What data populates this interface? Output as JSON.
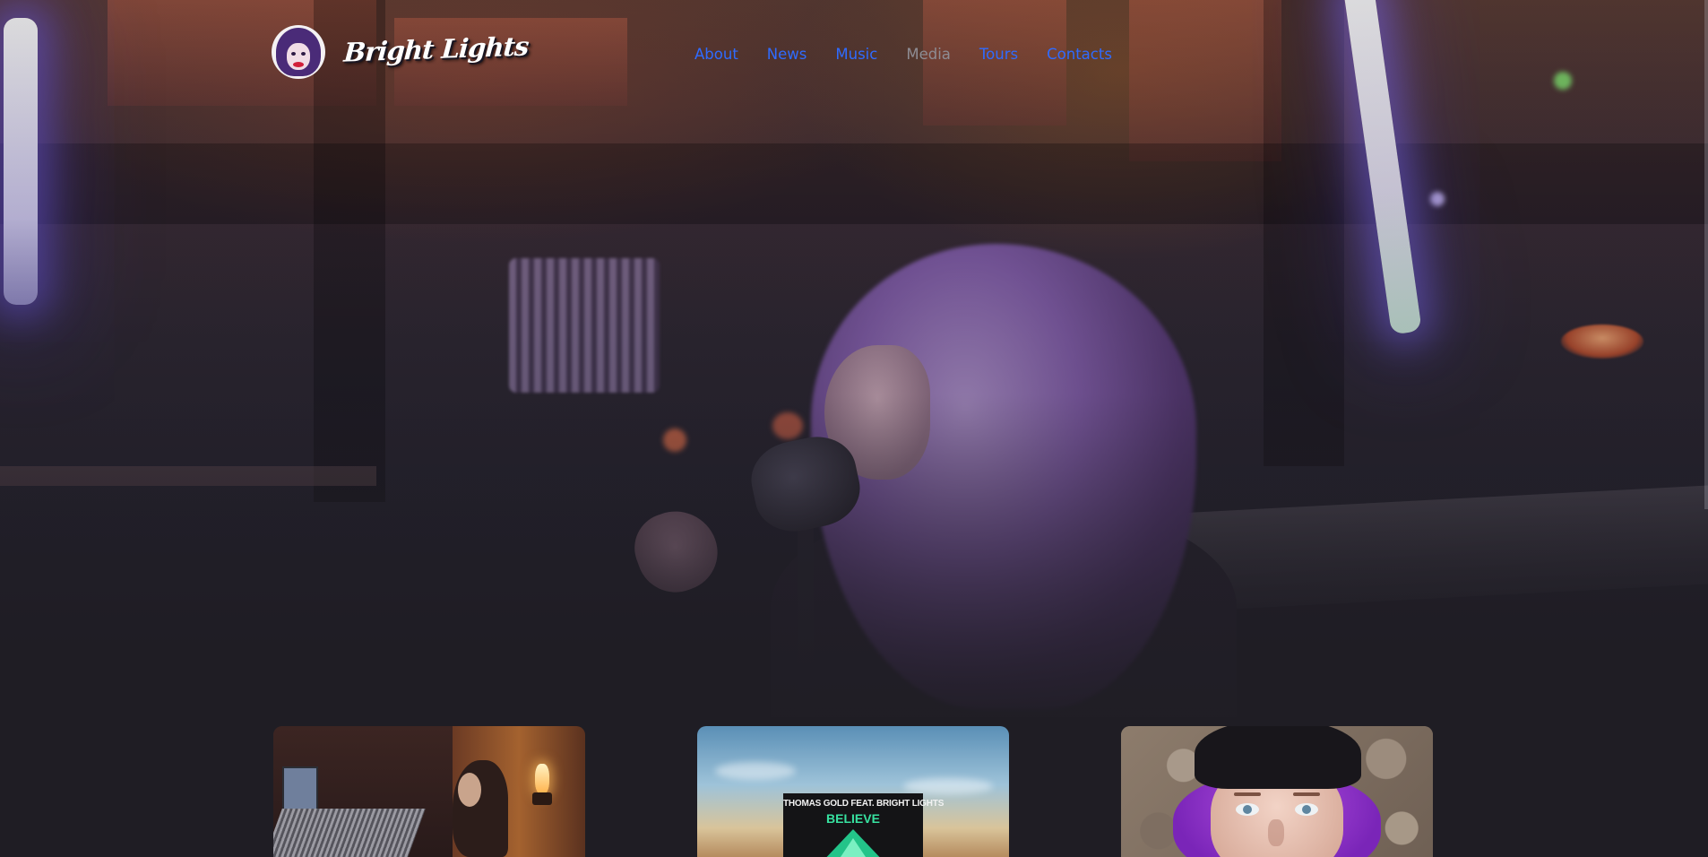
{
  "header": {
    "logo_alt": "Bright Lights",
    "wordmark": "Bright Lights",
    "nav": [
      {
        "label": "About",
        "active": false
      },
      {
        "label": "News",
        "active": false
      },
      {
        "label": "Music",
        "active": false
      },
      {
        "label": "Media",
        "active": true
      },
      {
        "label": "Tours",
        "active": false
      },
      {
        "label": "Contacts",
        "active": false
      }
    ]
  },
  "theme": {
    "nav_link_color": "#2f6bff",
    "nav_active_color": "#8e8c93",
    "page_background": "#1f1d24",
    "neon_glow": "#826eff"
  },
  "hero": {
    "image_subject": "singer-recording-in-studio"
  },
  "media_cards": [
    {
      "image_subject": "studio-mixing-console"
    },
    {
      "image_subject": "single-cover",
      "cover_artist": "THOMAS GOLD FEAT. BRIGHT LIGHTS",
      "cover_title": "BELIEVE"
    },
    {
      "image_subject": "portrait-purple-hair-beanie"
    }
  ]
}
